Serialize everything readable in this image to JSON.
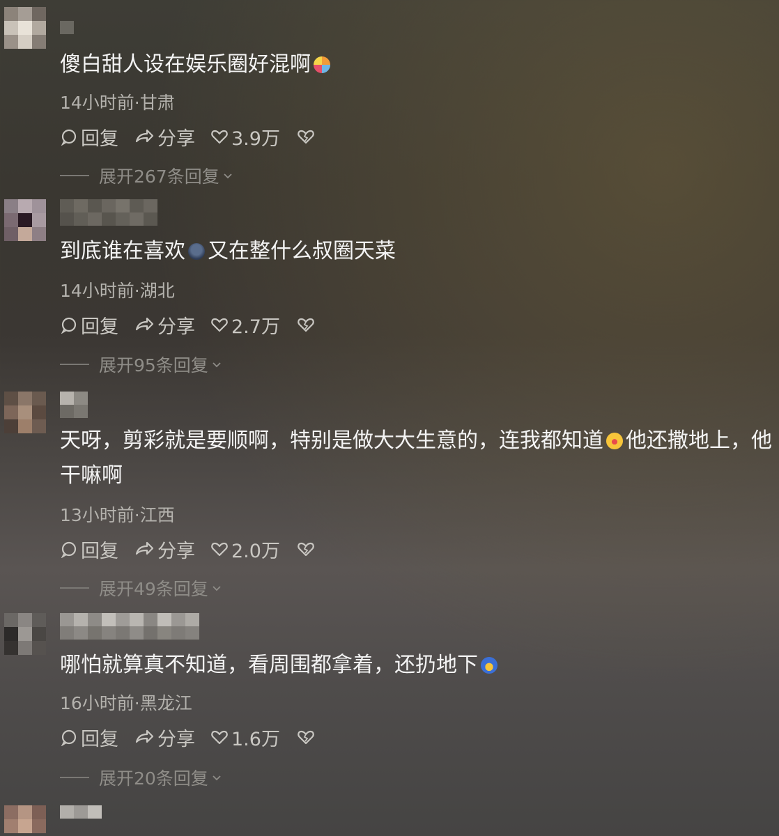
{
  "comments": [
    {
      "text_before": "傻白甜人设在娱乐圈好混啊",
      "emoji1": "face-emoji",
      "text_after": "",
      "meta": "14小时前·甘肃",
      "reply_label": "回复",
      "share_label": "分享",
      "likes": "3.9万",
      "expand": "展开267条回复"
    },
    {
      "text_before": "到底谁在喜欢",
      "emoji1": "face-emoji",
      "text_after": "又在整什么叔圈天菜",
      "meta": "14小时前·湖北",
      "reply_label": "回复",
      "share_label": "分享",
      "likes": "2.7万",
      "expand": "展开95条回复"
    },
    {
      "text_before": "天呀，剪彩就是要顺啊，特别是做大大生意的，连我都知道",
      "emoji1": "laughing-crying-emoji",
      "text_after": "他还撒地上，他干嘛啊",
      "meta": "13小时前·江西",
      "reply_label": "回复",
      "share_label": "分享",
      "likes": "2.0万",
      "expand": "展开49条回复"
    },
    {
      "text_before": "哪怕就算真不知道，看周围都拿着，还扔地下",
      "emoji1": "scared-emoji",
      "text_after": "",
      "meta": "16小时前·黑龙江",
      "reply_label": "回复",
      "share_label": "分享",
      "likes": "1.6万",
      "expand": "展开20条回复"
    }
  ],
  "colors": {
    "text": "#f4f4f4",
    "meta": "#b4b2ad",
    "action": "#c9c7c2",
    "expand": "#8f8d88"
  }
}
